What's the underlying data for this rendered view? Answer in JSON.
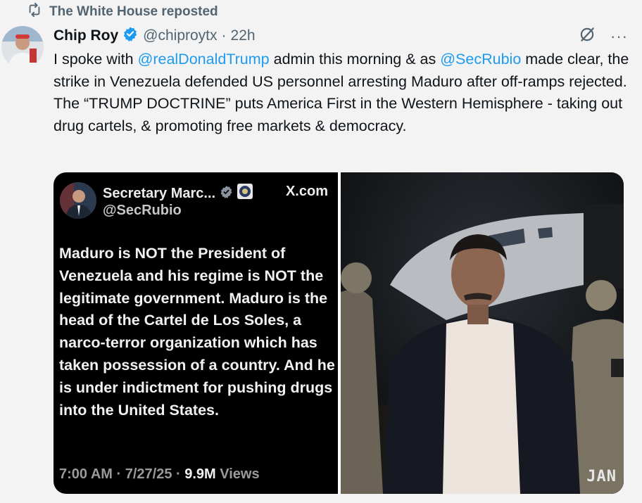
{
  "repost": {
    "label": "The White House reposted"
  },
  "post": {
    "author_name": "Chip Roy",
    "handle": "@chiproytx",
    "separator": "·",
    "time": "22h",
    "more_label": "···",
    "text": {
      "p1": "I spoke with ",
      "mention1": "@realDonaldTrump",
      "p2": " admin this morning & as ",
      "mention2": "@SecRubio",
      "p3": " made clear, the strike in Venezuela defended US personnel arresting Maduro after off-ramps rejected. The “TRUMP DOCTRINE” puts America First in the Western Hemisphere - taking out drug cartels, & promoting free markets & democracy."
    }
  },
  "quoted_image": {
    "name": "Secretary Marc...",
    "handle": "@SecRubio",
    "platform": "X.com",
    "body": "Maduro is NOT the President of Venezuela and his regime is NOT the legitimate government. Maduro is the head of the Cartel de Los Soles, a narco-terror organization which has taken possession of a country.  And he is under indictment for pushing drugs into the United States.",
    "footer_time": "7:00 AM · 7/27/25 · ",
    "footer_views_count": "9.9M",
    "footer_views_label": " Views"
  },
  "photo": {
    "tag": "JAN"
  },
  "icons": {
    "repost": "repost-icon",
    "verified": "verified-badge-icon",
    "grok": "grok-icon",
    "more": "more-icon"
  },
  "colors": {
    "accent": "#1d9bf0",
    "muted": "#536471",
    "background": "#f3f3f3"
  }
}
